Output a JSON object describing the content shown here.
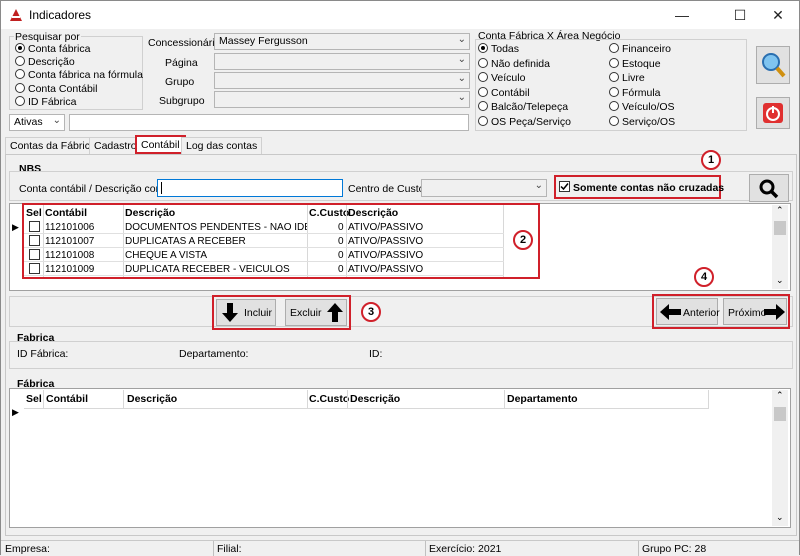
{
  "window": {
    "title": "Indicadores"
  },
  "search_by": {
    "legend": "Pesquisar por",
    "options": [
      "Conta fábrica",
      "Descrição",
      "Conta fábrica na fórmula",
      "Conta Contábil",
      "ID Fábrica"
    ],
    "selected": "Conta fábrica"
  },
  "filters": {
    "status_value": "Ativas",
    "search_value": "",
    "concessionaria_label": "Concessionária",
    "concessionaria_value": "Massey Fergusson",
    "pagina_label": "Página",
    "grupo_label": "Grupo",
    "subgrupo_label": "Subgrupo"
  },
  "area": {
    "legend": "Conta Fábrica X Área Negócio",
    "col1": [
      "Todas",
      "Não definida",
      "Veículo",
      "Contábil",
      "Balcão/Telepeça",
      "OS Peça/Serviço"
    ],
    "col2": [
      "Financeiro",
      "Estoque",
      "Livre",
      "Fórmula",
      "Veículo/OS",
      "Serviço/OS"
    ],
    "selected": "Todas"
  },
  "tabs": [
    "Contas da Fábrica",
    "Cadastro",
    "Contábil",
    "Log das contas"
  ],
  "active_tab": "Contábil",
  "nbs": {
    "title": "NBS",
    "conta_label": "Conta contábil / Descrição conta",
    "conta_value": "",
    "centro_label": "Centro de Custo",
    "centro_value": "",
    "somente_label": "Somente contas não cruzadas",
    "somente_checked": true,
    "columns": [
      "Sel",
      "Contábil",
      "Descrição",
      "C.Custo",
      "Descrição"
    ],
    "rows": [
      {
        "sel": false,
        "contabil": "112101006",
        "descricao": "DOCUMENTOS PENDENTES - NAO IDENTIFIC",
        "ccusto": "0",
        "descricao2": "ATIVO/PASSIVO"
      },
      {
        "sel": false,
        "contabil": "112101007",
        "descricao": "DUPLICATAS A RECEBER",
        "ccusto": "0",
        "descricao2": "ATIVO/PASSIVO"
      },
      {
        "sel": false,
        "contabil": "112101008",
        "descricao": "CHEQUE A VISTA",
        "ccusto": "0",
        "descricao2": "ATIVO/PASSIVO"
      },
      {
        "sel": false,
        "contabil": "112101009",
        "descricao": "DUPLICATA RECEBER - VEICULOS",
        "ccusto": "0",
        "descricao2": "ATIVO/PASSIVO"
      }
    ]
  },
  "actions": {
    "incluir": "Incluir",
    "excluir": "Excluir",
    "anterior": "Anterior",
    "proximo": "Próximo"
  },
  "fabrica": {
    "title": "Fabrica",
    "id_label": "ID Fábrica:",
    "depto_label": "Departamento:",
    "id2_label": "ID:",
    "grid_title": "Fábrica",
    "columns": [
      "Sel",
      "Contábil",
      "Descrição",
      "C.Custo",
      "Descrição",
      "Departamento"
    ]
  },
  "callouts": [
    "1",
    "2",
    "3",
    "4"
  ],
  "status": {
    "empresa": "Empresa:",
    "filial": "Filial:",
    "exercicio": "Exercício: 2021",
    "grupo_pc": "Grupo PC: 28"
  },
  "colors": {
    "accent_red": "#d0202a",
    "selection_blue": "#0078d7"
  }
}
